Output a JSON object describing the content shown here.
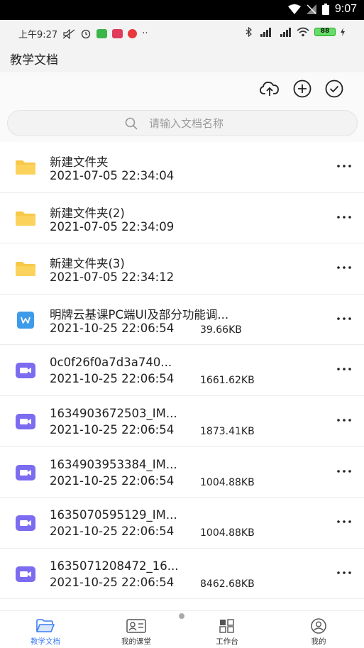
{
  "system": {
    "time": "9:07"
  },
  "phone_status": {
    "time": "上午9:27",
    "dots": "··",
    "battery": "88"
  },
  "header": {
    "title": "教学文档"
  },
  "toolbar": {
    "upload_icon": "cloud-upload-icon",
    "add_icon": "plus-circle-icon",
    "select_icon": "check-circle-icon"
  },
  "search": {
    "placeholder": "请输入文档名称",
    "value": ""
  },
  "colors": {
    "accent": "#3c7cf0",
    "folder": "#f7c948",
    "video": "#7b6cf0",
    "word": "#3d9be9"
  },
  "files": [
    {
      "type": "folder",
      "name": "新建文件夹",
      "date": "2021-07-05 22:34:04",
      "size": ""
    },
    {
      "type": "folder",
      "name": "新建文件夹(2)",
      "date": "2021-07-05 22:34:09",
      "size": ""
    },
    {
      "type": "folder",
      "name": "新建文件夹(3)",
      "date": "2021-07-05 22:34:12",
      "size": ""
    },
    {
      "type": "word",
      "name": "明牌云基课PC端UI及部分功能调...",
      "date": "2021-10-25 22:06:54",
      "size": "39.66KB"
    },
    {
      "type": "video",
      "name": "0c0f26f0a7d3a740...",
      "date": "2021-10-25 22:06:54",
      "size": "1661.62KB"
    },
    {
      "type": "video",
      "name": "1634903672503_IM...",
      "date": "2021-10-25 22:06:54",
      "size": "1873.41KB"
    },
    {
      "type": "video",
      "name": "1634903953384_IM...",
      "date": "2021-10-25 22:06:54",
      "size": "1004.88KB"
    },
    {
      "type": "video",
      "name": "1635070595129_IM...",
      "date": "2021-10-25 22:06:54",
      "size": "1004.88KB"
    },
    {
      "type": "video",
      "name": "1635071208472_16...",
      "date": "2021-10-25 22:06:54",
      "size": "8462.68KB"
    }
  ],
  "tabs": [
    {
      "label": "教学文档",
      "icon": "folder-open-icon",
      "active": true
    },
    {
      "label": "我的课堂",
      "icon": "classroom-icon",
      "active": false
    },
    {
      "label": "工作台",
      "icon": "workbench-icon",
      "active": false
    },
    {
      "label": "我的",
      "icon": "user-icon",
      "active": false
    }
  ]
}
